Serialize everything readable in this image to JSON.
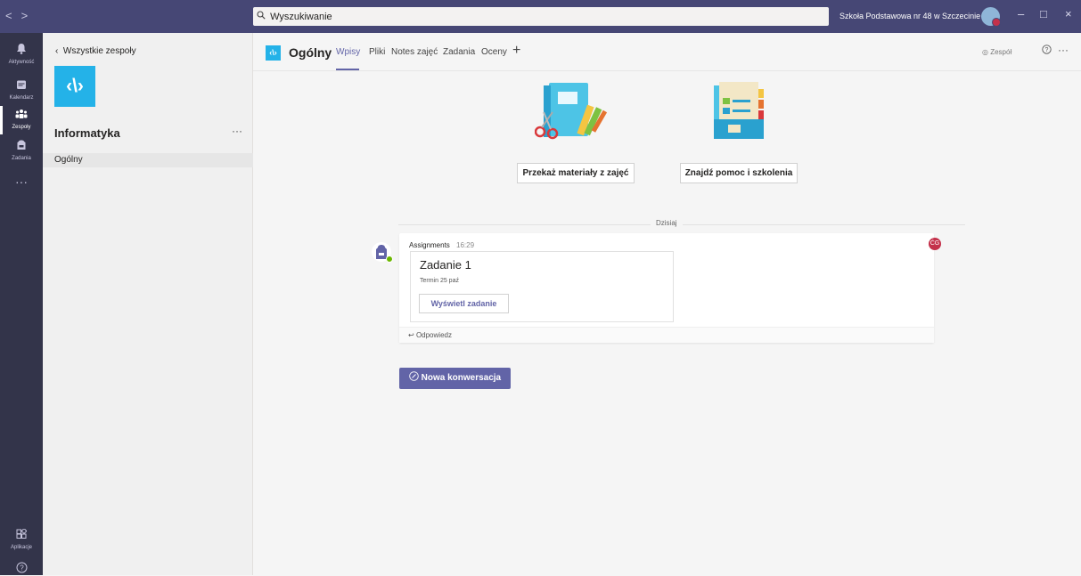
{
  "titlebar": {
    "nav_back": "<",
    "nav_forward": ">",
    "search_placeholder": "Wyszukiwanie",
    "org_name": "Szkoła Podstawowa nr 48 w Szczecinie ⌄",
    "minimize": "–",
    "maximize": "□",
    "close": "×"
  },
  "rail": {
    "items": [
      {
        "label": "Aktywność",
        "icon": "bell-icon"
      },
      {
        "label": "Kalendarz",
        "icon": "calendar-icon"
      },
      {
        "label": "Zespoły",
        "icon": "teams-icon"
      },
      {
        "label": "Zadania",
        "icon": "assignments-icon"
      },
      {
        "label": "Aplikacje",
        "icon": "apps-icon"
      }
    ],
    "more": "···",
    "help": "?"
  },
  "sidebar": {
    "back_label": "Wszystkie zespoły",
    "team_logo": "‹\\›",
    "team_name": "Informatyka",
    "more": "···",
    "channels": [
      "Ogólny"
    ]
  },
  "header": {
    "channel_logo": "‹\\›",
    "channel_name": "Ogólny",
    "tabs": [
      "Wpisy",
      "Pliki",
      "Notes zajęć",
      "Zadania",
      "Oceny"
    ],
    "add_tab": "+",
    "team_badge": "Zespół",
    "help": "?",
    "more": "···"
  },
  "welcome": {
    "button_1": "Przekaż materiały z zajęć",
    "button_2": "Znajdź pomoc i szkolenia"
  },
  "feed": {
    "date_divider": "Dzisiaj",
    "message": {
      "author": "Assignments",
      "time": "16:29",
      "reaction": "ĆG",
      "card_title": "Zadanie 1",
      "card_due": "Termin 25 paź",
      "card_button": "Wyświetl zadanie",
      "reply": "Odpowiedz"
    }
  },
  "compose": {
    "new_conversation": "Nowa konwersacja"
  }
}
